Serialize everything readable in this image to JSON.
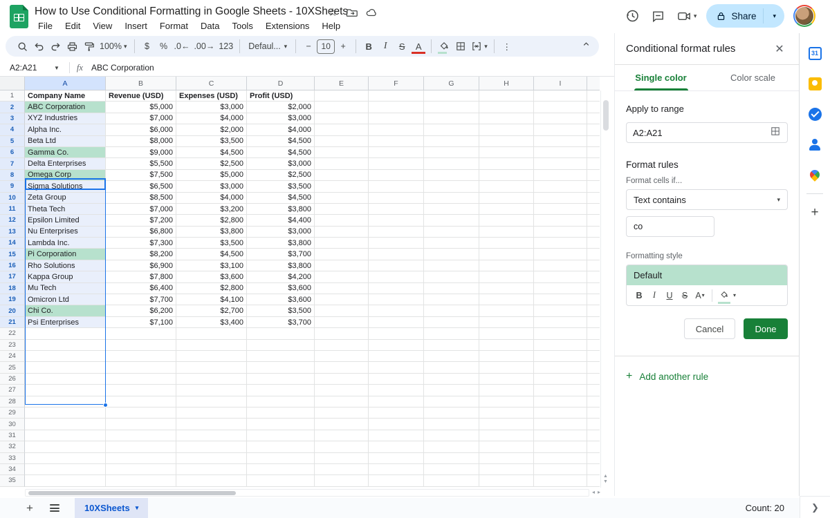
{
  "titlebar": {
    "title": "How to Use Conditional Formatting in Google Sheets - 10XSheets",
    "menus": [
      "File",
      "Edit",
      "View",
      "Insert",
      "Format",
      "Data",
      "Tools",
      "Extensions",
      "Help"
    ],
    "share_label": "Share"
  },
  "toolbar": {
    "zoom": "100%",
    "number_format": "123",
    "font_name": "Defaul...",
    "font_size": "10",
    "minus": "−",
    "plus": "+"
  },
  "formula_bar": {
    "name_box": "A2:A21",
    "fx": "fx",
    "content": "ABC Corporation"
  },
  "grid": {
    "column_letters": [
      "A",
      "B",
      "C",
      "D",
      "E",
      "F",
      "G",
      "H",
      "I"
    ],
    "header_row": [
      "Company Name",
      "Revenue (USD)",
      "Expenses (USD)",
      "Profit (USD)"
    ],
    "total_rows": 35,
    "rows": [
      {
        "company": "ABC Corporation",
        "revenue": "$5,000",
        "expenses": "$3,000",
        "profit": "$2,000",
        "highlighted": true
      },
      {
        "company": "XYZ Industries",
        "revenue": "$7,000",
        "expenses": "$4,000",
        "profit": "$3,000",
        "highlighted": false
      },
      {
        "company": "Alpha Inc.",
        "revenue": "$6,000",
        "expenses": "$2,000",
        "profit": "$4,000",
        "highlighted": false
      },
      {
        "company": "Beta Ltd",
        "revenue": "$8,000",
        "expenses": "$3,500",
        "profit": "$4,500",
        "highlighted": false
      },
      {
        "company": "Gamma Co.",
        "revenue": "$9,000",
        "expenses": "$4,500",
        "profit": "$4,500",
        "highlighted": true
      },
      {
        "company": "Delta Enterprises",
        "revenue": "$5,500",
        "expenses": "$2,500",
        "profit": "$3,000",
        "highlighted": false
      },
      {
        "company": "Omega Corp",
        "revenue": "$7,500",
        "expenses": "$5,000",
        "profit": "$2,500",
        "highlighted": true
      },
      {
        "company": "Sigma Solutions",
        "revenue": "$6,500",
        "expenses": "$3,000",
        "profit": "$3,500",
        "highlighted": false
      },
      {
        "company": "Zeta Group",
        "revenue": "$8,500",
        "expenses": "$4,000",
        "profit": "$4,500",
        "highlighted": false
      },
      {
        "company": "Theta Tech",
        "revenue": "$7,000",
        "expenses": "$3,200",
        "profit": "$3,800",
        "highlighted": false
      },
      {
        "company": "Epsilon Limited",
        "revenue": "$7,200",
        "expenses": "$2,800",
        "profit": "$4,400",
        "highlighted": false
      },
      {
        "company": "Nu Enterprises",
        "revenue": "$6,800",
        "expenses": "$3,800",
        "profit": "$3,000",
        "highlighted": false
      },
      {
        "company": "Lambda Inc.",
        "revenue": "$7,300",
        "expenses": "$3,500",
        "profit": "$3,800",
        "highlighted": false
      },
      {
        "company": "Pi Corporation",
        "revenue": "$8,200",
        "expenses": "$4,500",
        "profit": "$3,700",
        "highlighted": true
      },
      {
        "company": "Rho Solutions",
        "revenue": "$6,900",
        "expenses": "$3,100",
        "profit": "$3,800",
        "highlighted": false
      },
      {
        "company": "Kappa Group",
        "revenue": "$7,800",
        "expenses": "$3,600",
        "profit": "$4,200",
        "highlighted": false
      },
      {
        "company": "Mu Tech",
        "revenue": "$6,400",
        "expenses": "$2,800",
        "profit": "$3,600",
        "highlighted": false
      },
      {
        "company": "Omicron Ltd",
        "revenue": "$7,700",
        "expenses": "$4,100",
        "profit": "$3,600",
        "highlighted": false
      },
      {
        "company": "Chi Co.",
        "revenue": "$6,200",
        "expenses": "$2,700",
        "profit": "$3,500",
        "highlighted": true
      },
      {
        "company": "Psi Enterprises",
        "revenue": "$7,100",
        "expenses": "$3,400",
        "profit": "$3,700",
        "highlighted": false
      }
    ]
  },
  "panel": {
    "title": "Conditional format rules",
    "tabs": {
      "single_color": "Single color",
      "color_scale": "Color scale"
    },
    "apply_to_range_label": "Apply to range",
    "range_value": "A2:A21",
    "format_rules_label": "Format rules",
    "format_cells_if_label": "Format cells if...",
    "condition": "Text contains",
    "condition_value": "co",
    "formatting_style_label": "Formatting style",
    "preview_text": "Default",
    "cancel_label": "Cancel",
    "done_label": "Done",
    "add_rule_label": "Add another rule"
  },
  "sheetbar": {
    "tab_name": "10XSheets",
    "count_label": "Count: 20"
  },
  "colors": {
    "highlight_green": "#b7e1cd",
    "accent_green": "#188038",
    "selection_blue": "#1a73e8",
    "share_bg": "#c2e7ff",
    "tab_blue": "#0b57d0"
  }
}
